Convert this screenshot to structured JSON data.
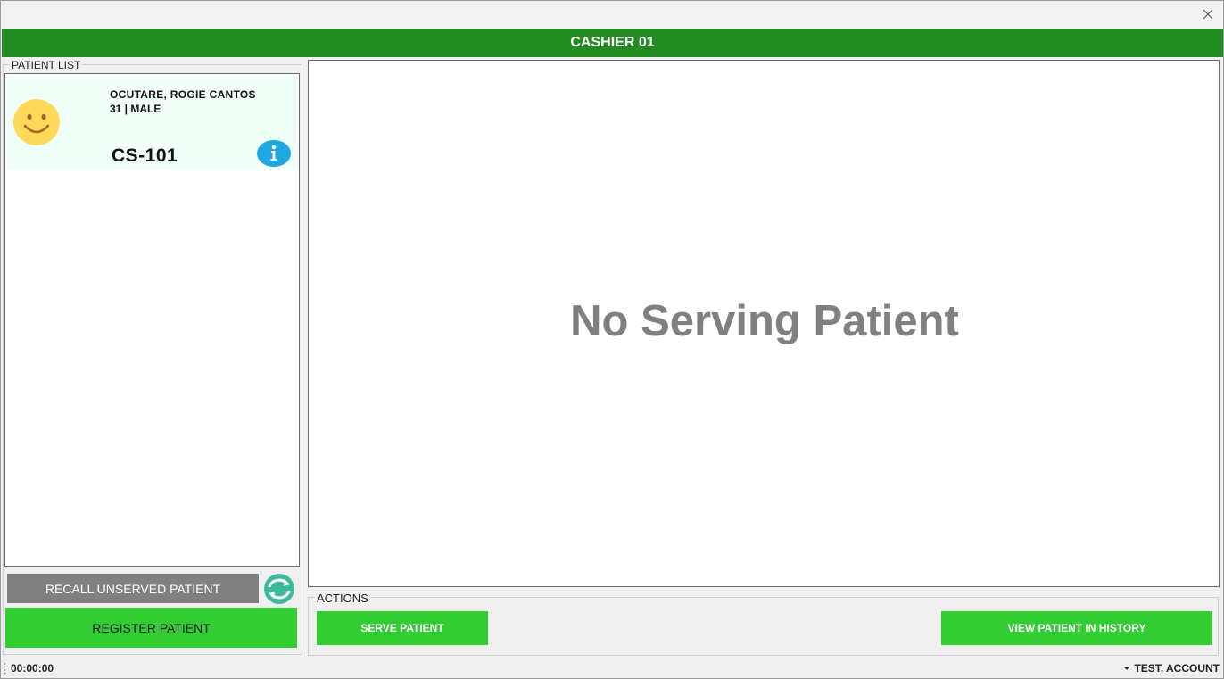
{
  "header": {
    "title": "CASHIER 01"
  },
  "patient_list": {
    "legend": "PATIENT LIST",
    "patients": [
      {
        "name": "OCUTARE, ROGIE CANTOS",
        "info": "31 | MALE",
        "code": "CS-101",
        "avatar_icon": "smiley-icon",
        "details_icon": "info-icon"
      }
    ],
    "recall_label": "RECALL UNSERVED PATIENT",
    "register_label": "REGISTER PATIENT",
    "refresh_icon": "refresh-icon"
  },
  "main": {
    "empty_message": "No Serving Patient"
  },
  "actions": {
    "legend": "ACTIONS",
    "serve_label": "SERVE PATIENT",
    "history_label": "VIEW PATIENT IN HISTORY"
  },
  "status": {
    "timer": "00:00:00",
    "user": "TEST, ACCOUNT"
  },
  "colors": {
    "header_green": "#228b22",
    "button_green": "#32cd32",
    "recall_gray": "#808080",
    "info_blue": "#1ea7e1",
    "refresh_teal": "#3cb89a",
    "smiley_yellow": "#ffd95a"
  }
}
